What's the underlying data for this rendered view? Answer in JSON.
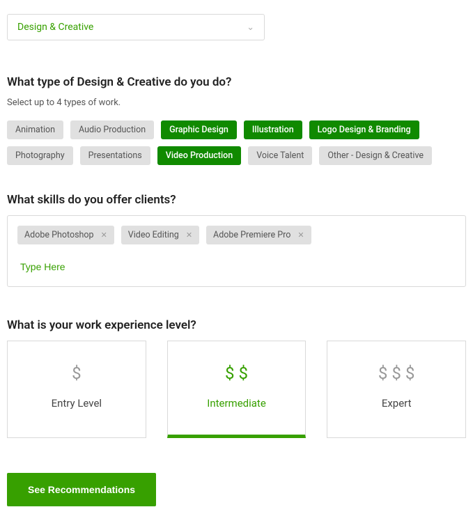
{
  "dropdown": {
    "label": "Design & Creative"
  },
  "typeSection": {
    "title": "What type of Design & Creative do you do?",
    "subtext": "Select up to 4 types of work.",
    "chips": [
      {
        "label": "Animation",
        "selected": false
      },
      {
        "label": "Audio Production",
        "selected": false
      },
      {
        "label": "Graphic Design",
        "selected": true
      },
      {
        "label": "Illustration",
        "selected": true
      },
      {
        "label": "Logo Design & Branding",
        "selected": true
      },
      {
        "label": "Photography",
        "selected": false
      },
      {
        "label": "Presentations",
        "selected": false
      },
      {
        "label": "Video Production",
        "selected": true
      },
      {
        "label": "Voice Talent",
        "selected": false
      },
      {
        "label": "Other - Design & Creative",
        "selected": false
      }
    ]
  },
  "skillsSection": {
    "title": "What skills do you offer clients?",
    "tags": [
      {
        "label": "Adobe Photoshop"
      },
      {
        "label": "Video Editing"
      },
      {
        "label": "Adobe Premiere Pro"
      }
    ],
    "placeholder": "Type Here"
  },
  "expSection": {
    "title": "What is your work experience level?",
    "levels": [
      {
        "label": "Entry Level",
        "dollars": 1,
        "selected": false
      },
      {
        "label": "Intermediate",
        "dollars": 2,
        "selected": true
      },
      {
        "label": "Expert",
        "dollars": 3,
        "selected": false
      }
    ]
  },
  "cta": {
    "label": "See Recommendations"
  }
}
